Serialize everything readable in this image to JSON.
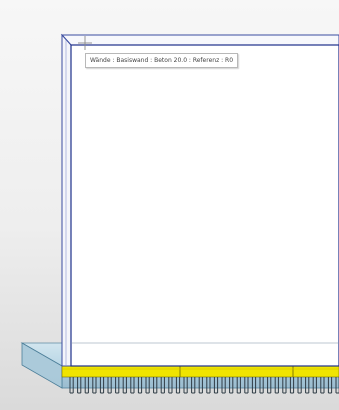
{
  "viewport": {
    "tooltip": {
      "text": "Wände : Basiswand : Beton 20.0 : Referenz : R0"
    }
  },
  "colors": {
    "wall_fill": "#ffffff",
    "wall_edge": "#1d2f8a",
    "slab_fill": "#a9cfe4",
    "slab_edge": "#4d7f99",
    "foundation_beam": "#f0e400",
    "rebar": "#2e3b45"
  },
  "icons": {
    "cursor": "crosshair-cursor-icon"
  }
}
